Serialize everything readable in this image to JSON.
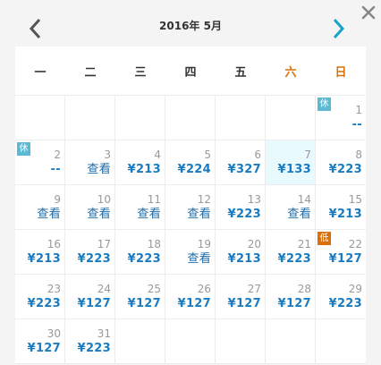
{
  "header": {
    "title": "2016年 5月"
  },
  "colors": {
    "accent": "#1a7bc1",
    "weekend": "#d9700b",
    "rest_tag": "#5cb8d3",
    "today_bg": "#e8fafd"
  },
  "icons": {
    "prev": "chevron-left-icon",
    "next": "chevron-right-icon",
    "close": "close-icon"
  },
  "weekdays": [
    "一",
    "二",
    "三",
    "四",
    "五",
    "六",
    "日"
  ],
  "tags": {
    "rest": "休",
    "promo": "低"
  },
  "weeks": [
    [
      null,
      null,
      null,
      null,
      null,
      null,
      {
        "day": "1",
        "price": "--",
        "tag": "rest"
      }
    ],
    [
      {
        "day": "2",
        "price": "--",
        "tag": "rest"
      },
      {
        "day": "3",
        "price": "查看"
      },
      {
        "day": "4",
        "price": "¥213"
      },
      {
        "day": "5",
        "price": "¥224"
      },
      {
        "day": "6",
        "price": "¥327"
      },
      {
        "day": "7",
        "price": "¥133",
        "today": true
      },
      {
        "day": "8",
        "price": "¥223"
      }
    ],
    [
      {
        "day": "9",
        "price": "查看"
      },
      {
        "day": "10",
        "price": "查看"
      },
      {
        "day": "11",
        "price": "查看"
      },
      {
        "day": "12",
        "price": "查看"
      },
      {
        "day": "13",
        "price": "¥223"
      },
      {
        "day": "14",
        "price": "查看"
      },
      {
        "day": "15",
        "price": "¥213"
      }
    ],
    [
      {
        "day": "16",
        "price": "¥213"
      },
      {
        "day": "17",
        "price": "¥223"
      },
      {
        "day": "18",
        "price": "¥223"
      },
      {
        "day": "19",
        "price": "查看"
      },
      {
        "day": "20",
        "price": "¥213"
      },
      {
        "day": "21",
        "price": "¥223"
      },
      {
        "day": "22",
        "price": "¥127",
        "tag": "promo"
      }
    ],
    [
      {
        "day": "23",
        "price": "¥223"
      },
      {
        "day": "24",
        "price": "¥127"
      },
      {
        "day": "25",
        "price": "¥127"
      },
      {
        "day": "26",
        "price": "¥127"
      },
      {
        "day": "27",
        "price": "¥127"
      },
      {
        "day": "28",
        "price": "¥127"
      },
      {
        "day": "29",
        "price": "¥223"
      }
    ],
    [
      {
        "day": "30",
        "price": "¥127"
      },
      {
        "day": "31",
        "price": "¥223"
      },
      null,
      null,
      null,
      null,
      null
    ]
  ]
}
